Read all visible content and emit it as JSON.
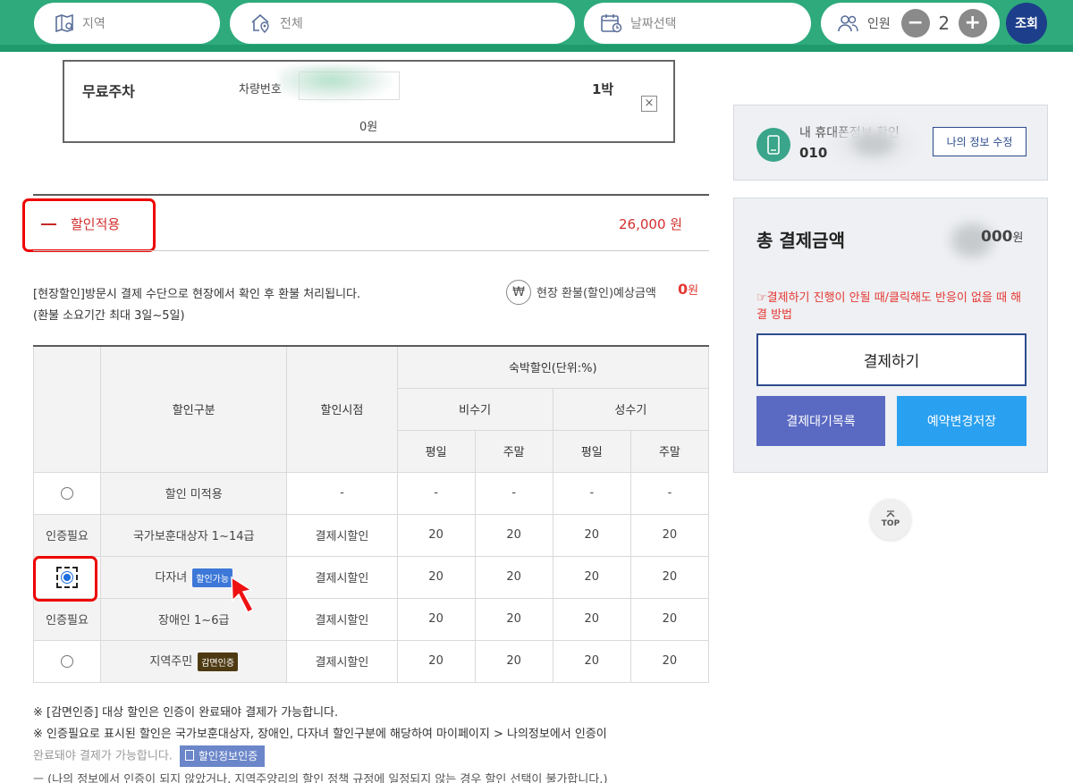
{
  "search": {
    "region_label": "지역",
    "type_label": "전체",
    "date_label": "날짜선택",
    "people_label": "인원",
    "people_count": "2",
    "minus": "−",
    "plus": "+",
    "search_button": "조회"
  },
  "parking": {
    "label": "무료주차",
    "car_number_label": "차량번호",
    "nights": "1박",
    "price": "0원",
    "close": "×"
  },
  "discount": {
    "dash": "—",
    "title": "할인적용",
    "amount": "26,000 원",
    "notice_line1": "[현장할인]방문시 결제 수단으로 현장에서 확인 후 환불 처리됩니다.",
    "notice_line2": "(환불 소요기간 최대 3일~5일)",
    "won_symbol": "₩",
    "refund_label": "현장 환불(할인)예상금액",
    "refund_value": "0",
    "refund_unit": "원"
  },
  "table": {
    "header": {
      "category": "할인구분",
      "timing": "할인시점",
      "stay_discount": "숙박할인(단위:%)",
      "off_season": "비수기",
      "peak_season": "성수기",
      "weekday": "평일",
      "weekend": "주말"
    },
    "rows": [
      {
        "select": "",
        "name": "할인 미적용",
        "badge": "",
        "timing": "-",
        "v1": "-",
        "v2": "-",
        "v3": "-",
        "v4": "-"
      },
      {
        "select": "인증필요",
        "name": "국가보훈대상자 1~14급",
        "badge": "",
        "timing": "결제시할인",
        "v1": "20",
        "v2": "20",
        "v3": "20",
        "v4": "20"
      },
      {
        "select": "",
        "name": "다자녀",
        "badge": "할인가능",
        "timing": "결제시할인",
        "v1": "20",
        "v2": "20",
        "v3": "20",
        "v4": "20"
      },
      {
        "select": "인증필요",
        "name": "장애인 1~6급",
        "badge": "",
        "timing": "결제시할인",
        "v1": "20",
        "v2": "20",
        "v3": "20",
        "v4": "20"
      },
      {
        "select": "",
        "name": "지역주민",
        "badge": "감면인증",
        "timing": "결제시할인",
        "v1": "20",
        "v2": "20",
        "v3": "20",
        "v4": "20"
      }
    ]
  },
  "notes": {
    "line1": "※ [감면인증] 대상 할인은 인증이 완료돼야 결제가 가능합니다.",
    "line2": "※ 인증필요로 표시된 할인은 국가보훈대상자, 장애인, 다자녀 할인구분에 해당하여 마이페이지 > 나의정보에서 인증이",
    "line3": "완료돼야 결제가 가능합니다.",
    "verify_button": "할인정보인증",
    "line4": "ㅡ (나의 정보에서 인증이 되지 않았거나, 지역주양리의 할인 정책 규정에 일정되지 않는 경우 할인 선택이 불가합니다.)"
  },
  "sidebar": {
    "phone_label": "내 휴대폰정보 확인",
    "phone_number": "010",
    "edit_button": "나의 정보 수정",
    "total_label": "총 결제금액",
    "total_amount": "000",
    "total_unit": "원",
    "warning": "☞결제하기 진행이 안될 때/클릭해도 반응이 없을 때 해결 방법",
    "pay_button": "결제하기",
    "wait_list_button": "결제대기목록",
    "save_button": "예약변경저장",
    "top_button": "TOP"
  },
  "colors": {
    "brand_green": "#2eaa7c",
    "navy": "#1d3e8a",
    "discount_red": "#d32f2f",
    "highlight_red": "#ee0000"
  }
}
